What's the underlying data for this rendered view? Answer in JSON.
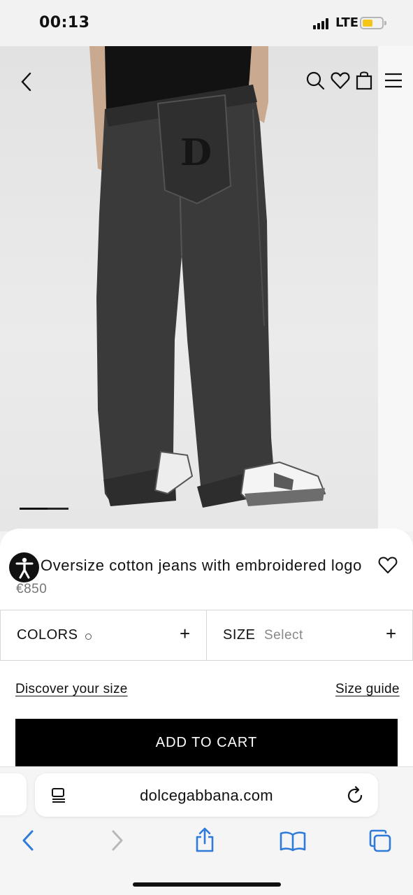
{
  "status_bar": {
    "time": "00:13",
    "network": "LTE",
    "battery_level": 0.4,
    "battery_color": "#f5c518"
  },
  "header_icons": [
    "back-chevron-icon",
    "search-icon",
    "heart-icon",
    "shopping-bag-icon",
    "menu-icon"
  ],
  "carousel": {
    "active_index": 0
  },
  "product": {
    "title": "Oversize cotton jeans with embroidered logo",
    "price": "€850"
  },
  "options": {
    "colors_label": "COLORS",
    "size_label": "SIZE",
    "size_placeholder": "Select",
    "expand_symbol": "+"
  },
  "links": {
    "discover_size": "Discover your size",
    "size_guide": "Size guide"
  },
  "cart": {
    "button_label": "ADD TO CART"
  },
  "browser": {
    "url": "dolcegabbana.com",
    "accent": "#2f7bd9"
  }
}
